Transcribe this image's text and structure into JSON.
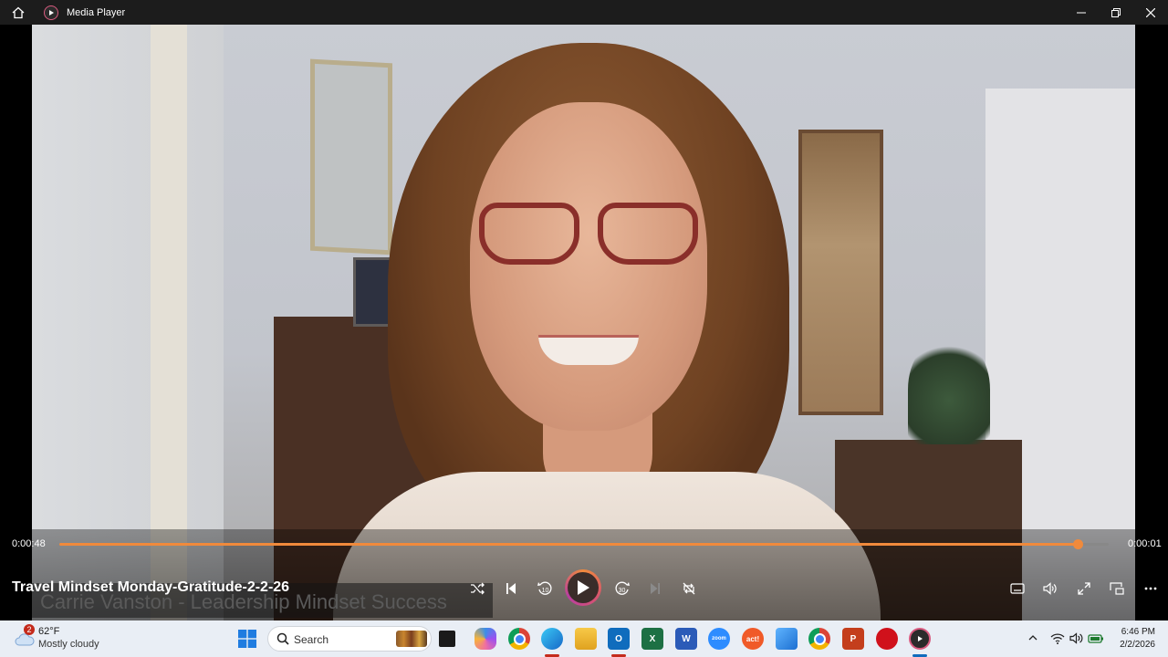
{
  "window": {
    "title": "Media Player"
  },
  "player": {
    "elapsed": "0:00:48",
    "remaining": "0:00:01",
    "progress_fraction": 0.97,
    "media_title": "Travel Mindset Monday-Gratitude-2-2-26",
    "video_lower_third": "Carrie Vanston - Leadership Mindset Success",
    "skip_back_label": "10",
    "skip_forward_label": "30",
    "accent_color": "#f08a3c"
  },
  "taskbar": {
    "weather": {
      "temperature": "62°F",
      "condition": "Mostly cloudy",
      "badge": "2"
    },
    "search_label": "Search",
    "apps": [
      "start-icon",
      "search",
      "file-explorer-thumbnails",
      "task-view",
      "copilot",
      "chrome",
      "edge",
      "file-explorer",
      "outlook",
      "excel",
      "word",
      "zoom",
      "act",
      "photos",
      "chrome-profile",
      "powerpoint",
      "acrobat",
      "media-player"
    ],
    "zoom_label": "zoom",
    "act_label": "act!"
  },
  "clock": {
    "time": "6:46 PM",
    "date": "2/2/2026"
  }
}
